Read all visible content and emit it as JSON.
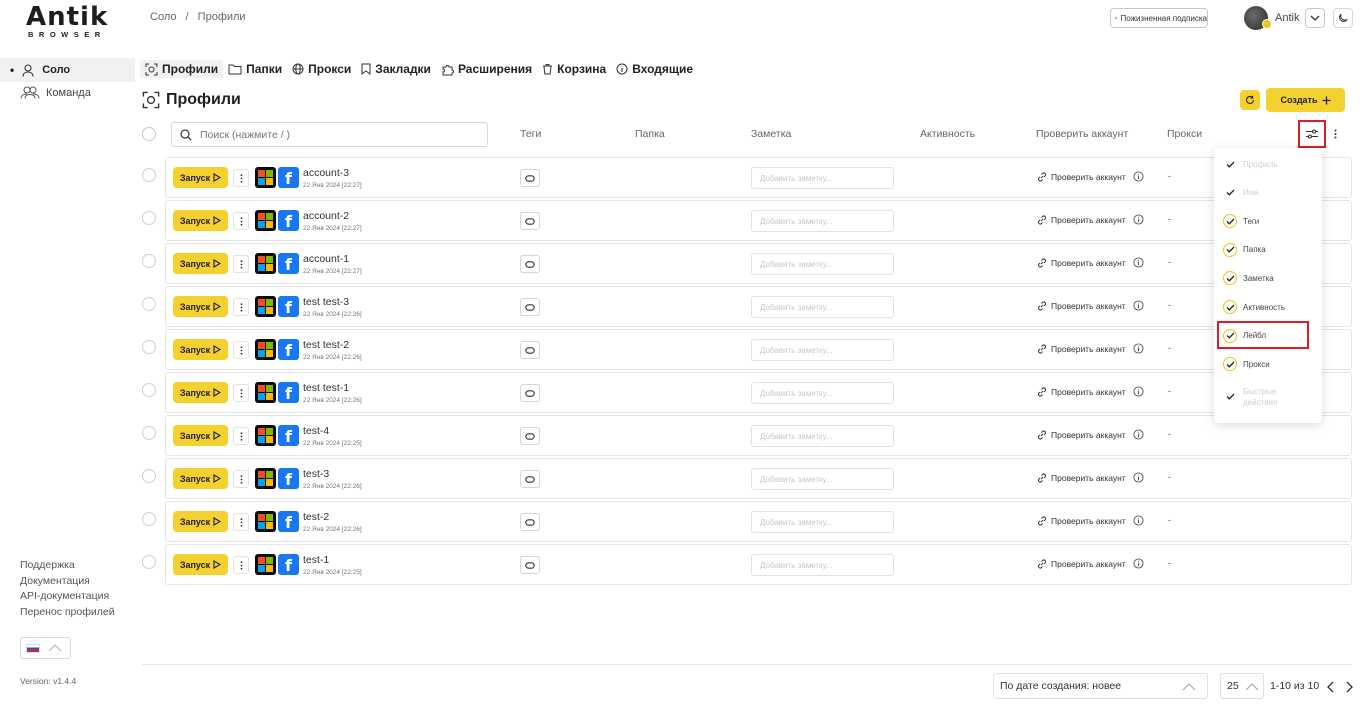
{
  "logo": {
    "line1": "Antik",
    "line2": "BROWSER"
  },
  "breadcrumb": {
    "root": "Соло",
    "sep": "/",
    "current": "Профили"
  },
  "topbar": {
    "subscription_label": "Пожизненная подписка",
    "username": "Antik"
  },
  "sidebar": {
    "solo_label": "Соло",
    "team_label": "Команда",
    "links": [
      "Поддержка",
      "Документация",
      "API-документация",
      "Перенос профилей"
    ],
    "version": "Version: v1.4.4"
  },
  "tabs": [
    {
      "label": "Профили",
      "icon": "profiles-icon",
      "active": true
    },
    {
      "label": "Папки",
      "icon": "folder-icon"
    },
    {
      "label": "Прокси",
      "icon": "proxy-icon"
    },
    {
      "label": "Закладки",
      "icon": "bookmark-icon"
    },
    {
      "label": "Расширения",
      "icon": "puzzle-icon"
    },
    {
      "label": "Корзина",
      "icon": "trash-icon"
    },
    {
      "label": "Входящие",
      "icon": "info-icon"
    }
  ],
  "page": {
    "title": "Профили",
    "create_label": "Создать"
  },
  "search": {
    "placeholder": "Поиск (нажмите / )"
  },
  "columns": {
    "tags": "Теги",
    "folder": "Папка",
    "note": "Заметка",
    "activity": "Активность",
    "check": "Проверить аккаунт",
    "proxy": "Прокси"
  },
  "row_labels": {
    "launch": "Запуск",
    "note_placeholder": "Добавить заметку...",
    "check": "Проверить аккаунт",
    "proxy_empty": "-"
  },
  "profiles": [
    {
      "name": "account-3",
      "date": "22 Янв 2024 [22:27]"
    },
    {
      "name": "account-2",
      "date": "22 Янв 2024 [22:27]"
    },
    {
      "name": "account-1",
      "date": "22 Янв 2024 [22:27]"
    },
    {
      "name": "test test-3",
      "date": "22 Янв 2024 [22:26]"
    },
    {
      "name": "test test-2",
      "date": "22 Янв 2024 [22:26]"
    },
    {
      "name": "test test-1",
      "date": "22 Янв 2024 [22:26]"
    },
    {
      "name": "test-4",
      "date": "22 Янв 2024 [22:25]"
    },
    {
      "name": "test-3",
      "date": "22 Янв 2024 [22:26]"
    },
    {
      "name": "test-2",
      "date": "22 Янв 2024 [22:26]"
    },
    {
      "name": "test-1",
      "date": "22 Янв 2024 [22:25]"
    }
  ],
  "column_menu": [
    {
      "label": "Профиль",
      "state": "disabled"
    },
    {
      "label": "Имя",
      "state": "disabled"
    },
    {
      "label": "Теги",
      "state": "on"
    },
    {
      "label": "Папка",
      "state": "on"
    },
    {
      "label": "Заметка",
      "state": "on"
    },
    {
      "label": "Активность",
      "state": "on"
    },
    {
      "label": "Лейбл",
      "state": "on"
    },
    {
      "label": "Прокси",
      "state": "on"
    },
    {
      "label": "Быстрые действия",
      "state": "disabled"
    }
  ],
  "footer": {
    "sort_label": "По дате создания: новее",
    "per_page": "25",
    "page_info": "1-10 из 10"
  },
  "colors": {
    "accent": "#f5d130",
    "highlight": "#e01b24",
    "facebook": "#1877f2"
  }
}
